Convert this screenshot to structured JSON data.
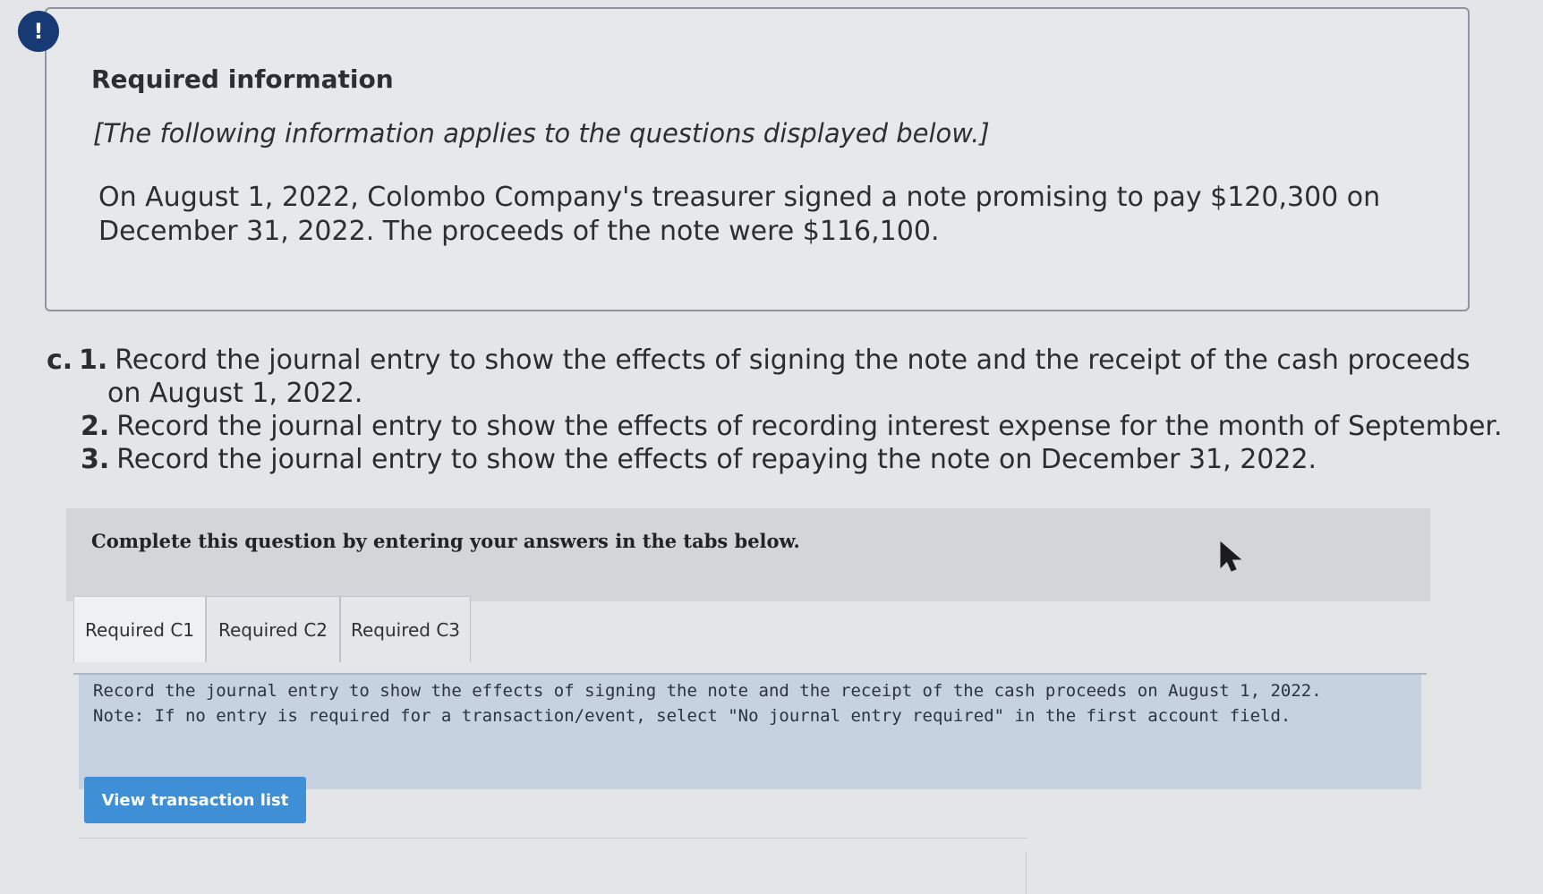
{
  "alert": {
    "icon_glyph": "!",
    "icon": "exclamation-icon"
  },
  "info": {
    "title": "Required information",
    "bracketed": "[The following information applies to the questions displayed below.]",
    "body_line1": "On August 1, 2022, Colombo Company's treasurer signed a note promising to pay $120,300 on",
    "body_line2": "December 31, 2022. The proceeds of the note were $116,100."
  },
  "questions": {
    "prefix": "c.",
    "items": [
      {
        "num": "1.",
        "text": "Record the journal entry to show the effects of signing the note and the receipt of the cash proceeds",
        "continuation": "on August 1, 2022."
      },
      {
        "num": "2.",
        "text": "Record the journal entry to show the effects of recording interest expense for the month of September."
      },
      {
        "num": "3.",
        "text": "Record the journal entry to show the effects of repaying the note on December 31, 2022."
      }
    ]
  },
  "instructions": {
    "text": "Complete this question by entering your answers in the tabs below."
  },
  "tabs": [
    {
      "label": "Required C1",
      "active": true
    },
    {
      "label": "Required C2",
      "active": false
    },
    {
      "label": "Required C3",
      "active": false
    }
  ],
  "panel": {
    "line1": "Record the journal entry to show the effects of signing the note and the receipt of the cash proceeds on August 1, 2022.",
    "line2": "Note: If no entry is required for a transaction/event, select \"No journal entry required\" in the first account field."
  },
  "button": {
    "label": "View transaction list"
  },
  "colors": {
    "alert_bg": "#173a74",
    "button_bg": "#3f8fd7",
    "panel_bg": "#c6d2df"
  }
}
